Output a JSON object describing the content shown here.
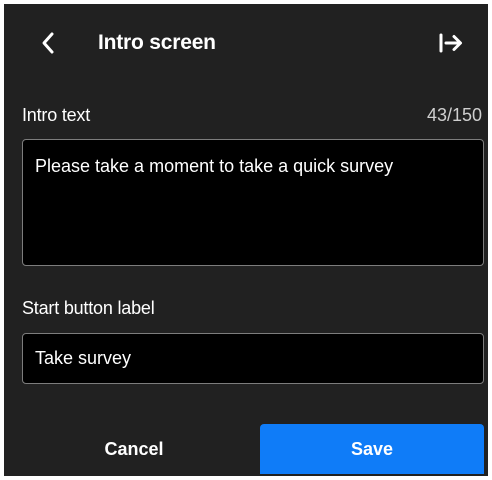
{
  "header": {
    "title": "Intro screen",
    "back_icon": "chevron-left-icon",
    "exit_icon": "arrow-right-to-bar-icon"
  },
  "intro": {
    "label": "Intro text",
    "counter": "43/150",
    "value": "Please take a moment to take a quick survey"
  },
  "start_button": {
    "label": "Start button label",
    "value": "Take survey"
  },
  "actions": {
    "cancel_label": "Cancel",
    "save_label": "Save"
  },
  "colors": {
    "panel_background": "#212121",
    "field_background": "#000000",
    "field_border": "#7d7d7d",
    "accent": "#0f7cf8"
  }
}
